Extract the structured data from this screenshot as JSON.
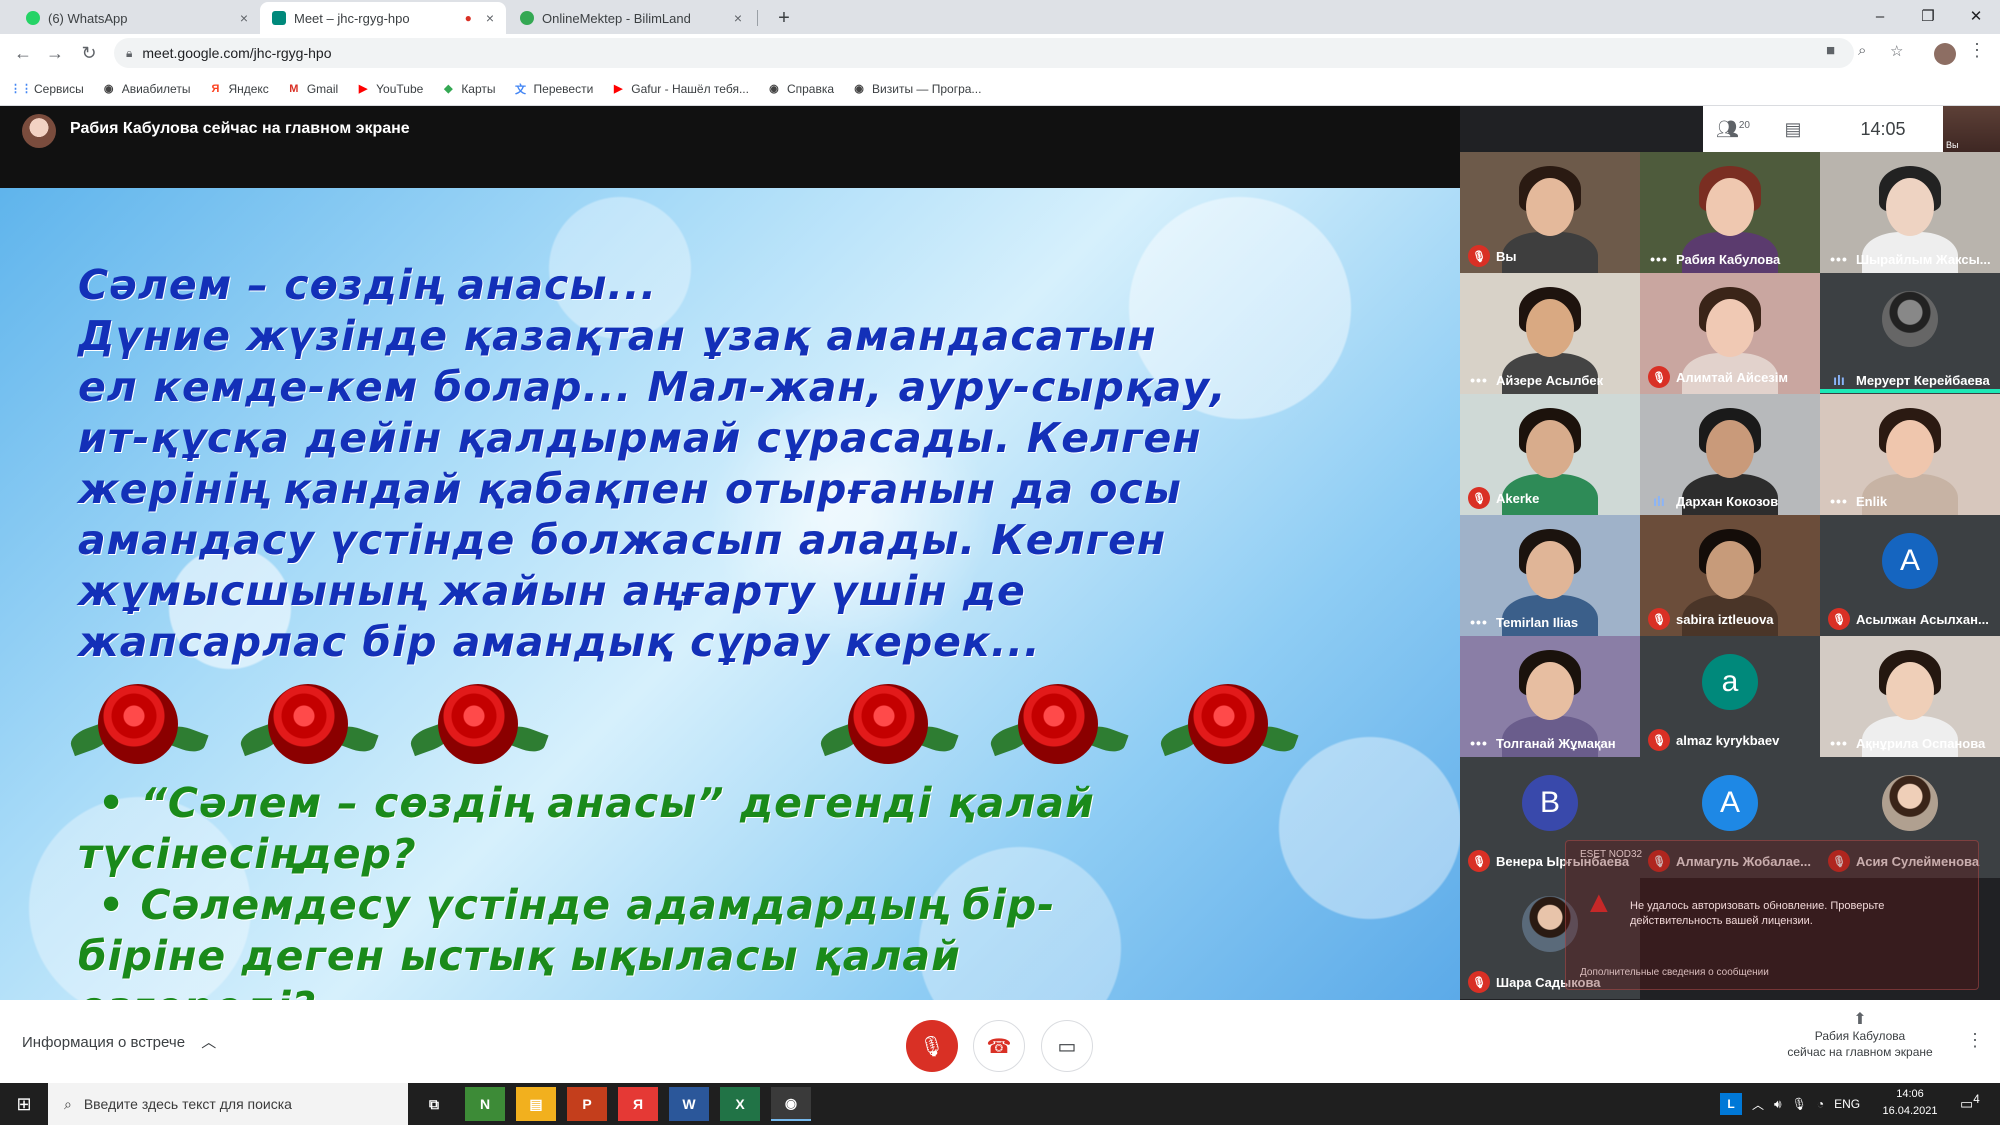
{
  "browser": {
    "tabs": [
      {
        "title": "(6) WhatsApp",
        "favicon_color": "#25d366",
        "close": "×"
      },
      {
        "title": "Meet – jhc-rgyg-hpo",
        "favicon_color": "#00897b",
        "close": "×",
        "recording": "●"
      },
      {
        "title": "OnlineMektep - BilimLand",
        "favicon_color": "#34a853",
        "close": "×"
      }
    ],
    "new_tab": "+",
    "window_controls": {
      "minimize": "–",
      "maximize": "❐",
      "close": "✕"
    },
    "nav": {
      "back": "←",
      "forward": "→",
      "reload": "↻"
    },
    "address": "meet.google.com/jhc-rgyg-hpo",
    "bookmarks": [
      {
        "label": "Сервисы",
        "icon": "apps-grid-icon",
        "glyph": "⋮⋮",
        "color": "#4285f4"
      },
      {
        "label": "Авиабилеты",
        "icon": "globe-icon",
        "glyph": "◉",
        "color": "#444"
      },
      {
        "label": "Яндекс",
        "icon": "yandex-icon",
        "glyph": "Я",
        "color": "#fc3f1d"
      },
      {
        "label": "Gmail",
        "icon": "gmail-icon",
        "glyph": "M",
        "color": "#d93025"
      },
      {
        "label": "YouTube",
        "icon": "youtube-icon",
        "glyph": "▶",
        "color": "#ff0000"
      },
      {
        "label": "Карты",
        "icon": "maps-icon",
        "glyph": "◆",
        "color": "#34a853"
      },
      {
        "label": "Перевести",
        "icon": "translate-icon",
        "glyph": "文",
        "color": "#4285f4"
      },
      {
        "label": "Gafur - Нашёл тебя...",
        "icon": "youtube-icon",
        "glyph": "▶",
        "color": "#ff0000"
      },
      {
        "label": "Справка",
        "icon": "globe-icon",
        "glyph": "◉",
        "color": "#444"
      },
      {
        "label": "Визиты — Програ...",
        "icon": "globe-icon",
        "glyph": "◉",
        "color": "#444"
      }
    ]
  },
  "meet": {
    "presenter_banner": "Рабия Кабулова сейчас на главном экране",
    "participants_count": "20",
    "time": "14:05",
    "self_label": "Вы",
    "slide": {
      "lines": [
        "Сәлем – сөздің анасы...",
        "Дүние жүзінде қазақтан ұзақ амандасатын",
        "ел кемде-кем болар... Мал-жан, ауру-сырқау,",
        "ит-құсқа дейін қалдырмай сұрасады. Келген",
        "жерінің қандай қабақпен отырғанын да осы",
        "амандасу үстінде болжасып алады. Келген",
        "жұмысшының жайын аңғарту үшін де",
        "жапсарлас бір амандық сұрау керек..."
      ],
      "questions": [
        "• “Сәлем – сөздің анасы” дегенді қалай",
        "түсінесіңдер?",
        "• Сәлемдесу үстінде адамдардың бір-",
        "біріне деген ыстық ықыласы қалай",
        "өзгереді?"
      ]
    },
    "participants": [
      {
        "name": "Вы",
        "status": "muted",
        "kind": "video",
        "bg": "#6d5a4a",
        "skin": "#e4b99b",
        "hair": "#2a1a12",
        "shirt": "#3e3e3e"
      },
      {
        "name": "Рабия Кабулова",
        "status": "dots",
        "kind": "video",
        "bg": "#4e5b3c",
        "skin": "#efc8b0",
        "hair": "#7a2e22",
        "shirt": "#5b3b6e"
      },
      {
        "name": "Шырайлым Жаксы...",
        "status": "dots",
        "kind": "video",
        "bg": "#b9b4ad",
        "skin": "#eed3c2",
        "hair": "#222",
        "shirt": "#eee"
      },
      {
        "name": "Айзере Асылбек",
        "status": "dots",
        "kind": "video",
        "bg": "#d8d2c8",
        "skin": "#d9a982",
        "hair": "#1e130e",
        "shirt": "#444"
      },
      {
        "name": "Алимтай Айсезім",
        "status": "muted",
        "kind": "video",
        "bg": "#c9a6a0",
        "skin": "#f0c9b4",
        "hair": "#3a2418",
        "shirt": "#e2d2cc"
      },
      {
        "name": "Меруерт Керейбаева",
        "status": "speaking",
        "kind": "photo",
        "bg": "#3c4043",
        "skin": "#888",
        "hair": "#222",
        "shirt": "#666"
      },
      {
        "name": "Akerke",
        "status": "muted",
        "kind": "video",
        "bg": "#cfd9d6",
        "skin": "#d8ac8c",
        "hair": "#1c120c",
        "shirt": "#2e8b57"
      },
      {
        "name": "Дархан Кокозов",
        "status": "speaking",
        "kind": "video",
        "bg": "#b7b9bb",
        "skin": "#c99a7a",
        "hair": "#1a1a1a",
        "shirt": "#2d2d2d"
      },
      {
        "name": "Enlik",
        "status": "dots",
        "kind": "video",
        "bg": "#d7c7bd",
        "skin": "#efc6ad",
        "hair": "#2b1a12",
        "shirt": "#c7b3a4"
      },
      {
        "name": "Temirlan Ilias",
        "status": "dots",
        "kind": "video",
        "bg": "#9fb2c9",
        "skin": "#e0b597",
        "hair": "#1b130e",
        "shirt": "#3b5f8a"
      },
      {
        "name": "sabira iztleuova",
        "status": "muted",
        "kind": "video",
        "bg": "#6b4d3a",
        "skin": "#c79b7a",
        "hair": "#140d09",
        "shirt": "#4a3528"
      },
      {
        "name": "Асылжан Асылхан...",
        "status": "muted",
        "kind": "letter",
        "letter": "A",
        "color": "#1565c0"
      },
      {
        "name": "Толганай Жұмақан",
        "status": "dots",
        "kind": "video",
        "bg": "#8a7ea6",
        "skin": "#e7bea1",
        "hair": "#1a120c",
        "shirt": "#6a5d8c"
      },
      {
        "name": "almaz kyrykbaev",
        "status": "muted",
        "kind": "letter",
        "letter": "a",
        "color": "#00897b"
      },
      {
        "name": "Ақнұрила Оспанова",
        "status": "dots",
        "kind": "video",
        "bg": "#d3cbc4",
        "skin": "#efcfb8",
        "hair": "#241710",
        "shirt": "#eee"
      },
      {
        "name": "Венера Ырғынбаева",
        "status": "muted",
        "kind": "letter",
        "letter": "B",
        "color": "#3949ab"
      },
      {
        "name": "Алмагуль Жобалае...",
        "status": "muted",
        "kind": "letter",
        "letter": "A",
        "color": "#1e88e5"
      },
      {
        "name": "Асия Сулейменова",
        "status": "muted",
        "kind": "photo",
        "bg": "#3c4043",
        "skin": "#efcfb8",
        "hair": "#3a2418",
        "shirt": "#b0a090"
      },
      {
        "name": "Шара Садыкова",
        "status": "muted",
        "kind": "photo",
        "bg": "#3c4043",
        "skin": "#e8c4aa",
        "hair": "#2a1a12",
        "shirt": "#5a6a7a"
      }
    ],
    "error_popup": {
      "message": "Не удалось авторизовать обновление. Проверьте действительность вашей лицензии.",
      "header": "ESET NOD32",
      "footer": "Дополнительные сведения о сообщении"
    },
    "bottom": {
      "meeting_info": "Информация о встрече",
      "mic_icon": "🎙",
      "hangup_icon": "☎",
      "camera_icon": "▭",
      "present_line1": "Рабия Кабулова",
      "present_line2": "сейчас на главном экране",
      "more": "⋮"
    }
  },
  "taskbar": {
    "search_placeholder": "Введите здесь текст для поиска",
    "apps": [
      {
        "name": "task-view",
        "glyph": "⧉",
        "bg": "transparent"
      },
      {
        "name": "app-green",
        "glyph": "N",
        "bg": "#3d8b37"
      },
      {
        "name": "explorer",
        "glyph": "▤",
        "bg": "#f2b01e"
      },
      {
        "name": "powerpoint",
        "glyph": "P",
        "bg": "#c43e1c"
      },
      {
        "name": "yandex",
        "glyph": "Я",
        "bg": "#e53935"
      },
      {
        "name": "word",
        "glyph": "W",
        "bg": "#2b579a"
      },
      {
        "name": "excel",
        "glyph": "X",
        "bg": "#217346"
      },
      {
        "name": "chrome",
        "glyph": "◉",
        "bg": "#3a3a3a"
      }
    ],
    "tray": {
      "app": "L",
      "lang": "ENG"
    },
    "clock_time": "14:06",
    "clock_date": "16.04.2021",
    "notif_count": "4"
  }
}
